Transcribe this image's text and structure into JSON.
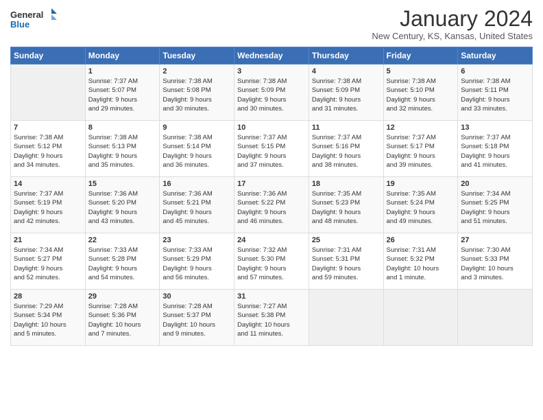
{
  "logo": {
    "line1": "General",
    "line2": "Blue"
  },
  "title": "January 2024",
  "subtitle": "New Century, KS, Kansas, United States",
  "headers": [
    "Sunday",
    "Monday",
    "Tuesday",
    "Wednesday",
    "Thursday",
    "Friday",
    "Saturday"
  ],
  "weeks": [
    [
      {
        "day": "",
        "info": ""
      },
      {
        "day": "1",
        "info": "Sunrise: 7:37 AM\nSunset: 5:07 PM\nDaylight: 9 hours\nand 29 minutes."
      },
      {
        "day": "2",
        "info": "Sunrise: 7:38 AM\nSunset: 5:08 PM\nDaylight: 9 hours\nand 30 minutes."
      },
      {
        "day": "3",
        "info": "Sunrise: 7:38 AM\nSunset: 5:09 PM\nDaylight: 9 hours\nand 30 minutes."
      },
      {
        "day": "4",
        "info": "Sunrise: 7:38 AM\nSunset: 5:09 PM\nDaylight: 9 hours\nand 31 minutes."
      },
      {
        "day": "5",
        "info": "Sunrise: 7:38 AM\nSunset: 5:10 PM\nDaylight: 9 hours\nand 32 minutes."
      },
      {
        "day": "6",
        "info": "Sunrise: 7:38 AM\nSunset: 5:11 PM\nDaylight: 9 hours\nand 33 minutes."
      }
    ],
    [
      {
        "day": "7",
        "info": "Sunrise: 7:38 AM\nSunset: 5:12 PM\nDaylight: 9 hours\nand 34 minutes."
      },
      {
        "day": "8",
        "info": "Sunrise: 7:38 AM\nSunset: 5:13 PM\nDaylight: 9 hours\nand 35 minutes."
      },
      {
        "day": "9",
        "info": "Sunrise: 7:38 AM\nSunset: 5:14 PM\nDaylight: 9 hours\nand 36 minutes."
      },
      {
        "day": "10",
        "info": "Sunrise: 7:37 AM\nSunset: 5:15 PM\nDaylight: 9 hours\nand 37 minutes."
      },
      {
        "day": "11",
        "info": "Sunrise: 7:37 AM\nSunset: 5:16 PM\nDaylight: 9 hours\nand 38 minutes."
      },
      {
        "day": "12",
        "info": "Sunrise: 7:37 AM\nSunset: 5:17 PM\nDaylight: 9 hours\nand 39 minutes."
      },
      {
        "day": "13",
        "info": "Sunrise: 7:37 AM\nSunset: 5:18 PM\nDaylight: 9 hours\nand 41 minutes."
      }
    ],
    [
      {
        "day": "14",
        "info": "Sunrise: 7:37 AM\nSunset: 5:19 PM\nDaylight: 9 hours\nand 42 minutes."
      },
      {
        "day": "15",
        "info": "Sunrise: 7:36 AM\nSunset: 5:20 PM\nDaylight: 9 hours\nand 43 minutes."
      },
      {
        "day": "16",
        "info": "Sunrise: 7:36 AM\nSunset: 5:21 PM\nDaylight: 9 hours\nand 45 minutes."
      },
      {
        "day": "17",
        "info": "Sunrise: 7:36 AM\nSunset: 5:22 PM\nDaylight: 9 hours\nand 46 minutes."
      },
      {
        "day": "18",
        "info": "Sunrise: 7:35 AM\nSunset: 5:23 PM\nDaylight: 9 hours\nand 48 minutes."
      },
      {
        "day": "19",
        "info": "Sunrise: 7:35 AM\nSunset: 5:24 PM\nDaylight: 9 hours\nand 49 minutes."
      },
      {
        "day": "20",
        "info": "Sunrise: 7:34 AM\nSunset: 5:25 PM\nDaylight: 9 hours\nand 51 minutes."
      }
    ],
    [
      {
        "day": "21",
        "info": "Sunrise: 7:34 AM\nSunset: 5:27 PM\nDaylight: 9 hours\nand 52 minutes."
      },
      {
        "day": "22",
        "info": "Sunrise: 7:33 AM\nSunset: 5:28 PM\nDaylight: 9 hours\nand 54 minutes."
      },
      {
        "day": "23",
        "info": "Sunrise: 7:33 AM\nSunset: 5:29 PM\nDaylight: 9 hours\nand 56 minutes."
      },
      {
        "day": "24",
        "info": "Sunrise: 7:32 AM\nSunset: 5:30 PM\nDaylight: 9 hours\nand 57 minutes."
      },
      {
        "day": "25",
        "info": "Sunrise: 7:31 AM\nSunset: 5:31 PM\nDaylight: 9 hours\nand 59 minutes."
      },
      {
        "day": "26",
        "info": "Sunrise: 7:31 AM\nSunset: 5:32 PM\nDaylight: 10 hours\nand 1 minute."
      },
      {
        "day": "27",
        "info": "Sunrise: 7:30 AM\nSunset: 5:33 PM\nDaylight: 10 hours\nand 3 minutes."
      }
    ],
    [
      {
        "day": "28",
        "info": "Sunrise: 7:29 AM\nSunset: 5:34 PM\nDaylight: 10 hours\nand 5 minutes."
      },
      {
        "day": "29",
        "info": "Sunrise: 7:28 AM\nSunset: 5:36 PM\nDaylight: 10 hours\nand 7 minutes."
      },
      {
        "day": "30",
        "info": "Sunrise: 7:28 AM\nSunset: 5:37 PM\nDaylight: 10 hours\nand 9 minutes."
      },
      {
        "day": "31",
        "info": "Sunrise: 7:27 AM\nSunset: 5:38 PM\nDaylight: 10 hours\nand 11 minutes."
      },
      {
        "day": "",
        "info": ""
      },
      {
        "day": "",
        "info": ""
      },
      {
        "day": "",
        "info": ""
      }
    ]
  ]
}
